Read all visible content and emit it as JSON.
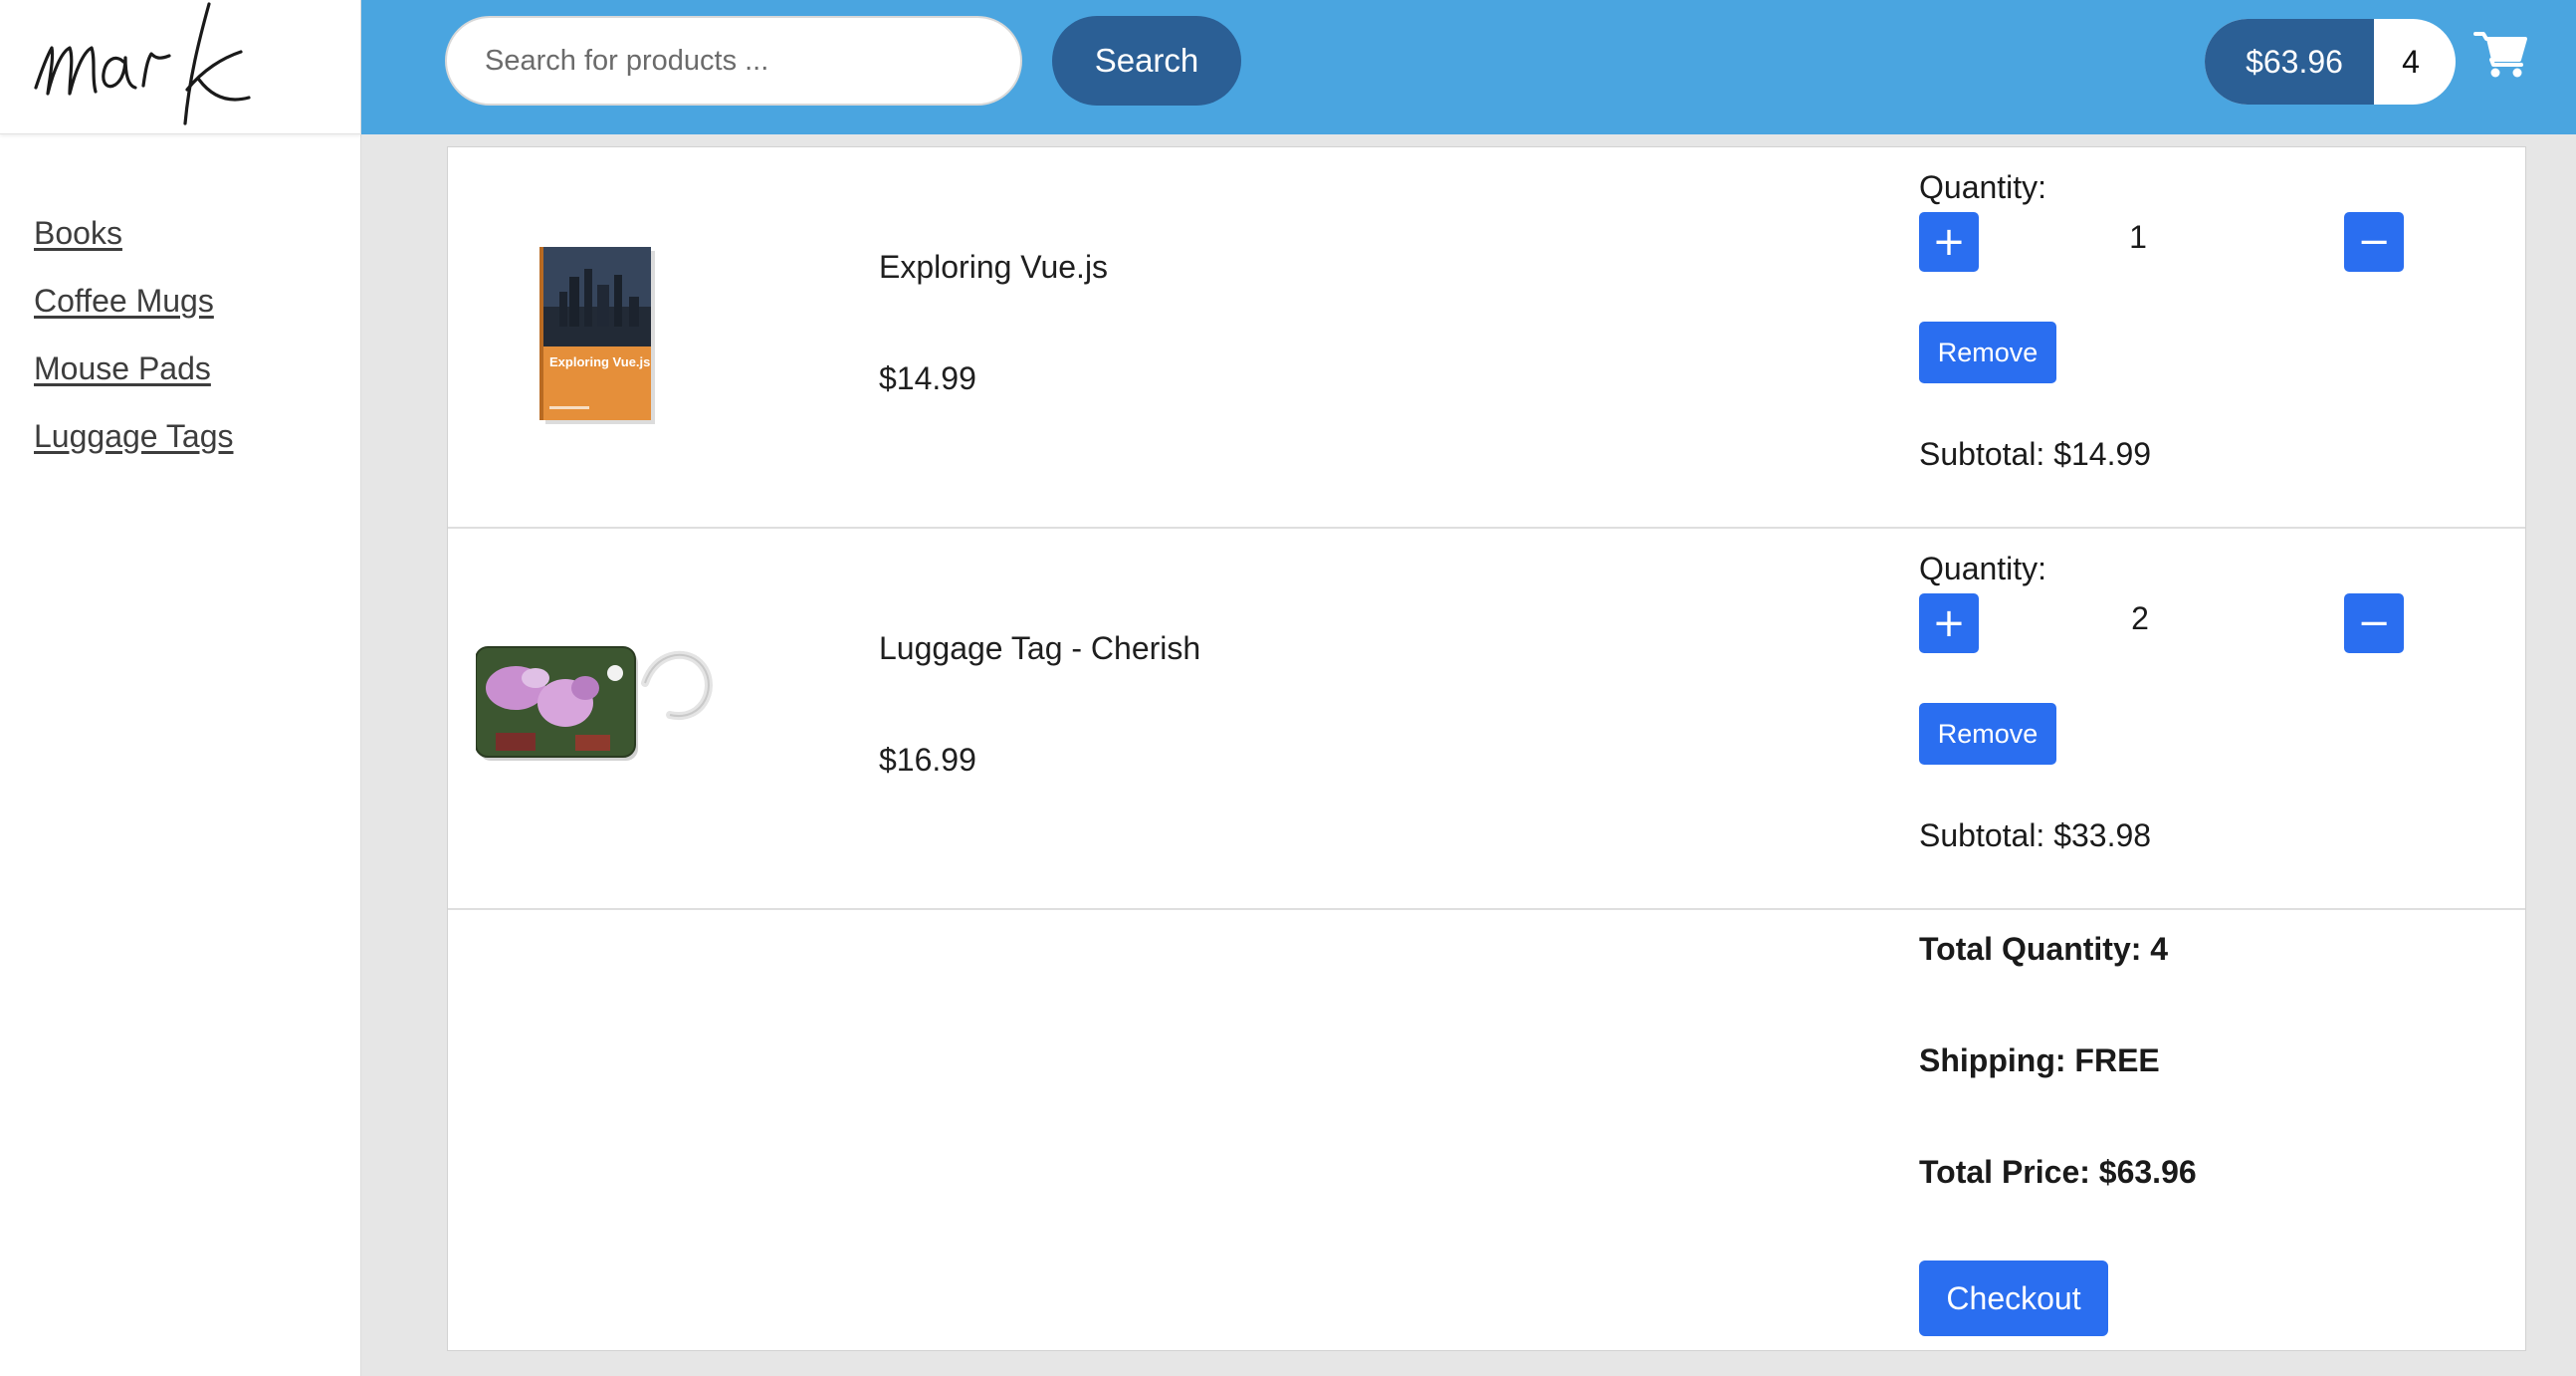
{
  "brand": {
    "logo_text": "mark"
  },
  "sidebar": {
    "items": [
      {
        "label": "Books"
      },
      {
        "label": "Coffee Mugs"
      },
      {
        "label": "Mouse Pads"
      },
      {
        "label": "Luggage Tags"
      }
    ]
  },
  "header": {
    "search_placeholder": "Search for products ...",
    "search_button": "Search",
    "cart_total": "$63.96",
    "cart_count": "4",
    "cart_icon": "shopping-cart-icon"
  },
  "cart": {
    "items": [
      {
        "name": "Exploring Vue.js",
        "price": "$14.99",
        "quantity_label": "Quantity:",
        "quantity": "1",
        "remove_label": "Remove",
        "subtotal": "Subtotal: $14.99",
        "image": "book-cover-thumbnail",
        "image_text": "Exploring Vue.js"
      },
      {
        "name": "Luggage Tag - Cherish",
        "price": "$16.99",
        "quantity_label": "Quantity:",
        "quantity": "2",
        "remove_label": "Remove",
        "subtotal": "Subtotal: $33.98",
        "image": "luggage-tag-thumbnail"
      }
    ],
    "summary": {
      "total_quantity": "Total Quantity: 4",
      "shipping": "Shipping: FREE",
      "total_price": "Total Price: $63.96",
      "checkout_label": "Checkout"
    }
  },
  "colors": {
    "header_bg": "#4aa5e0",
    "dark_button": "#2b5f95",
    "primary_button": "#2a6ef0"
  }
}
